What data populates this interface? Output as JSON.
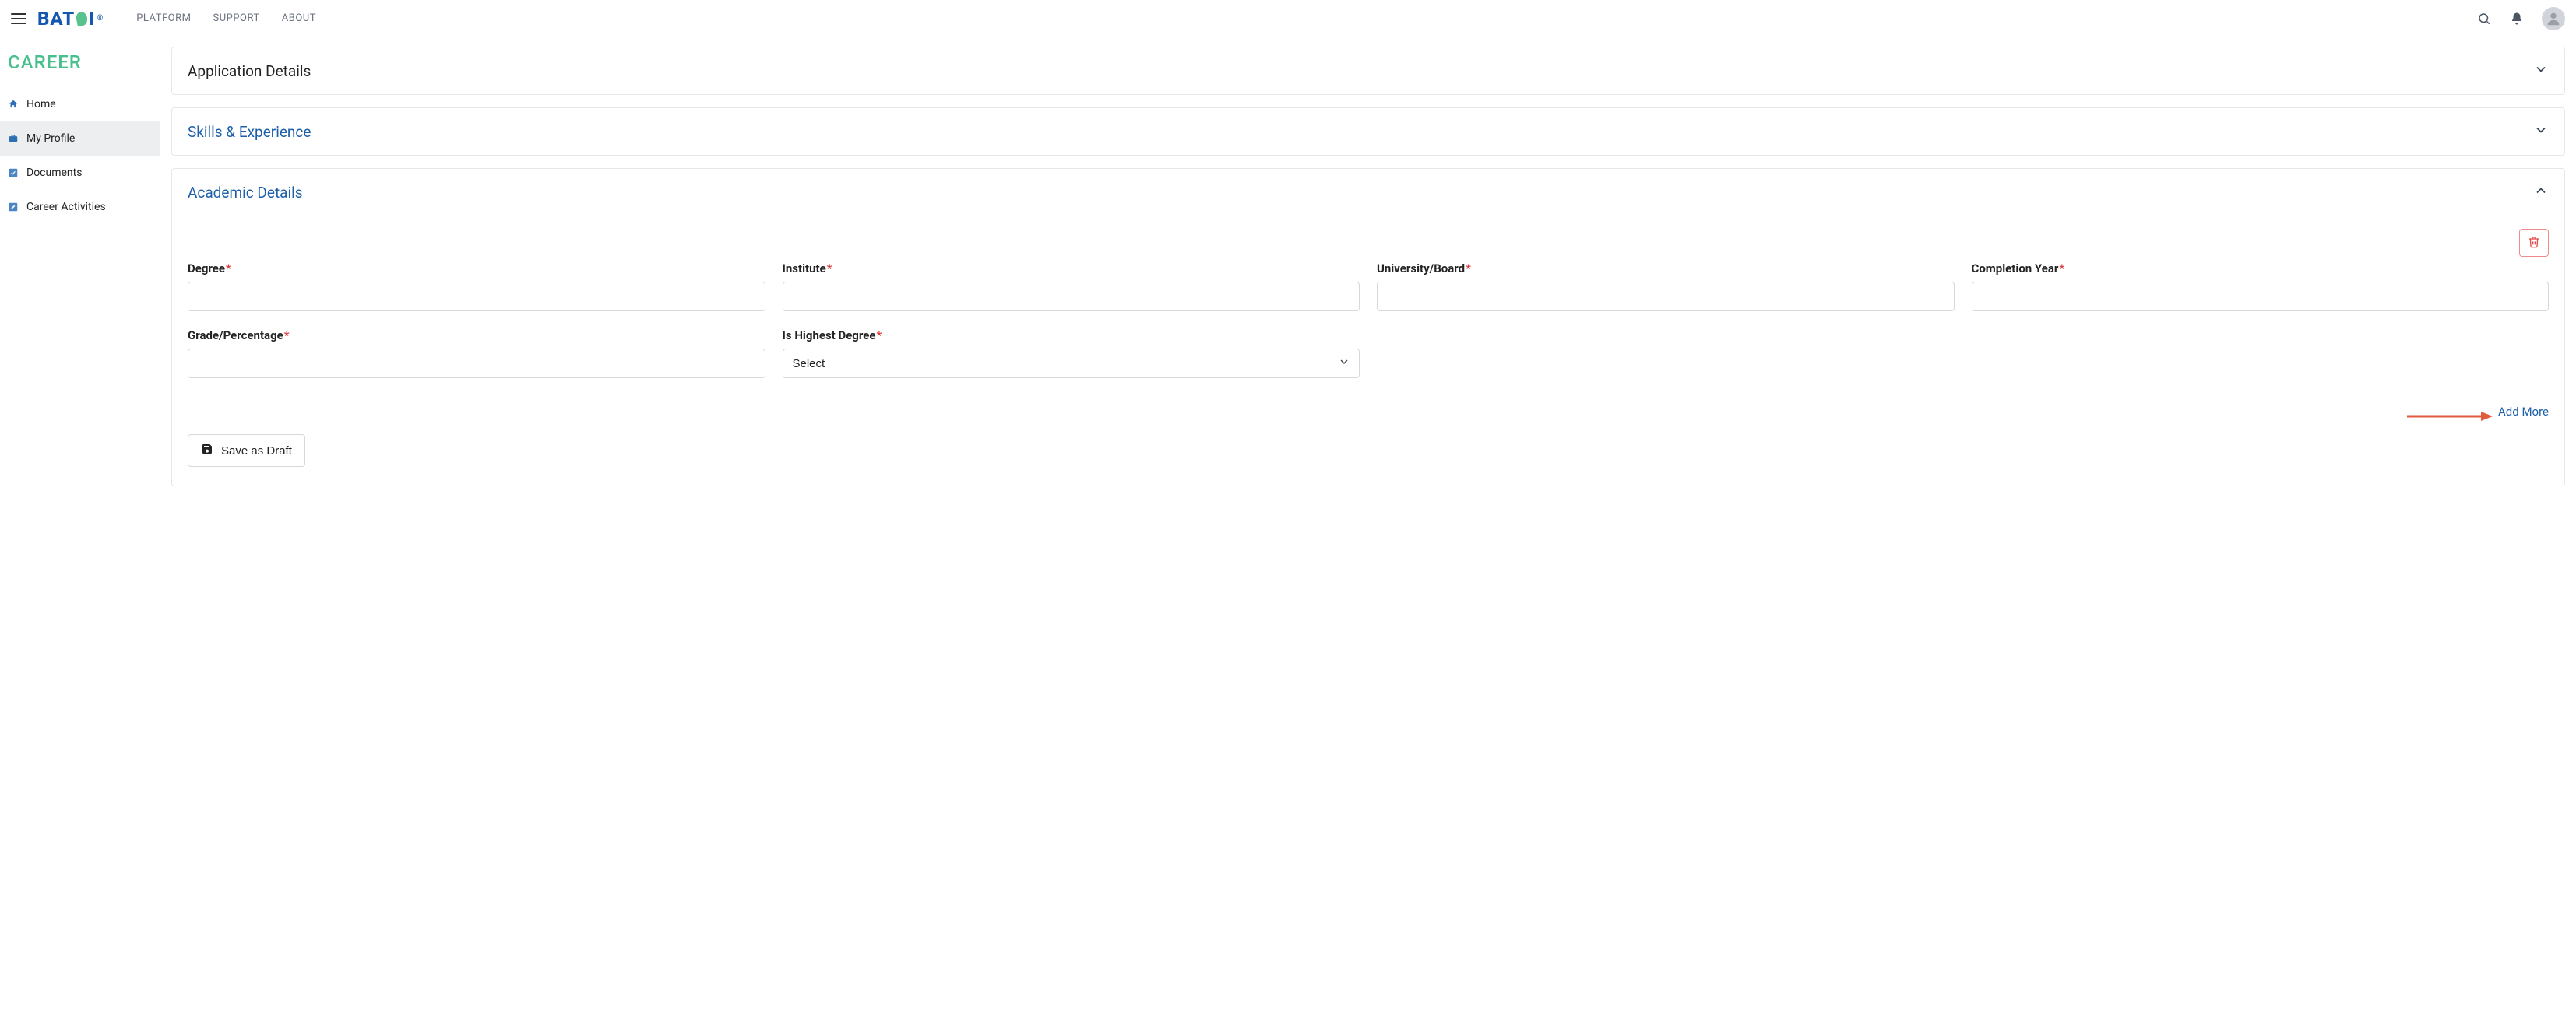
{
  "brand": {
    "text_left": "BAT",
    "text_right": "I",
    "reg": "®"
  },
  "topnav": {
    "platform": "PLATFORM",
    "support": "SUPPORT",
    "about": "ABOUT"
  },
  "sidebar": {
    "module_title": "CAREER",
    "items": [
      {
        "label": "Home"
      },
      {
        "label": "My Profile"
      },
      {
        "label": "Documents"
      },
      {
        "label": "Career Activities"
      }
    ]
  },
  "cards": {
    "application_details": {
      "title": "Application Details"
    },
    "skills_experience": {
      "title": "Skills & Experience"
    },
    "academic_details": {
      "title": "Academic Details",
      "form": {
        "degree_label": "Degree",
        "institute_label": "Institute",
        "university_label": "University/Board",
        "completion_year_label": "Completion Year",
        "grade_label": "Grade/Percentage",
        "highest_degree_label": "Is Highest Degree",
        "highest_degree_value": "Select"
      },
      "add_more_label": "Add More",
      "save_draft_label": "Save as Draft"
    }
  }
}
